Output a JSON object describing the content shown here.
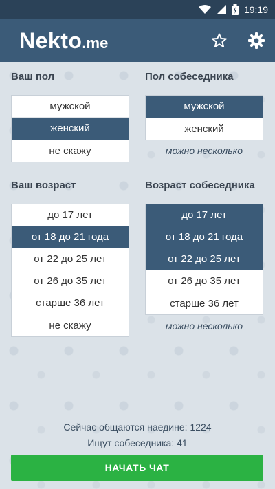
{
  "status_bar": {
    "time": "19:19",
    "icons": [
      "wifi-icon",
      "signal-icon",
      "battery-icon"
    ]
  },
  "app_bar": {
    "logo_main": "Nekto",
    "logo_dot": ".",
    "logo_suffix": "me",
    "actions": [
      "star-icon",
      "gear-icon"
    ]
  },
  "your_gender": {
    "title": "Ваш пол",
    "options": [
      {
        "label": "мужской",
        "selected": false
      },
      {
        "label": "женский",
        "selected": true
      },
      {
        "label": "не скажу",
        "selected": false
      }
    ]
  },
  "partner_gender": {
    "title": "Пол собеседника",
    "options": [
      {
        "label": "мужской",
        "selected": true
      },
      {
        "label": "женский",
        "selected": false
      }
    ],
    "hint": "можно несколько"
  },
  "your_age": {
    "title": "Ваш возраст",
    "options": [
      {
        "label": "до 17 лет",
        "selected": false
      },
      {
        "label": "от 18 до 21 года",
        "selected": true
      },
      {
        "label": "от 22 до 25 лет",
        "selected": false
      },
      {
        "label": "от 26 до 35 лет",
        "selected": false
      },
      {
        "label": "старше 36 лет",
        "selected": false
      },
      {
        "label": "не скажу",
        "selected": false
      }
    ]
  },
  "partner_age": {
    "title": "Возраст собеседника",
    "options": [
      {
        "label": "до 17 лет",
        "selected": true
      },
      {
        "label": "от 18 до 21 года",
        "selected": true
      },
      {
        "label": "от 22 до 25 лет",
        "selected": true
      },
      {
        "label": "от 26 до 35 лет",
        "selected": false
      },
      {
        "label": "старше 36 лет",
        "selected": false
      }
    ],
    "hint": "можно несколько"
  },
  "stats": {
    "chatting_now": "Сейчас общаются наедине: 1224",
    "searching": "Ищут собеседника: 41"
  },
  "start_button": "НАЧАТЬ ЧАТ",
  "colors": {
    "primary": "#3b5b78",
    "status_bar": "#2b4258",
    "start": "#2bb243",
    "background": "#dbe2e8"
  }
}
